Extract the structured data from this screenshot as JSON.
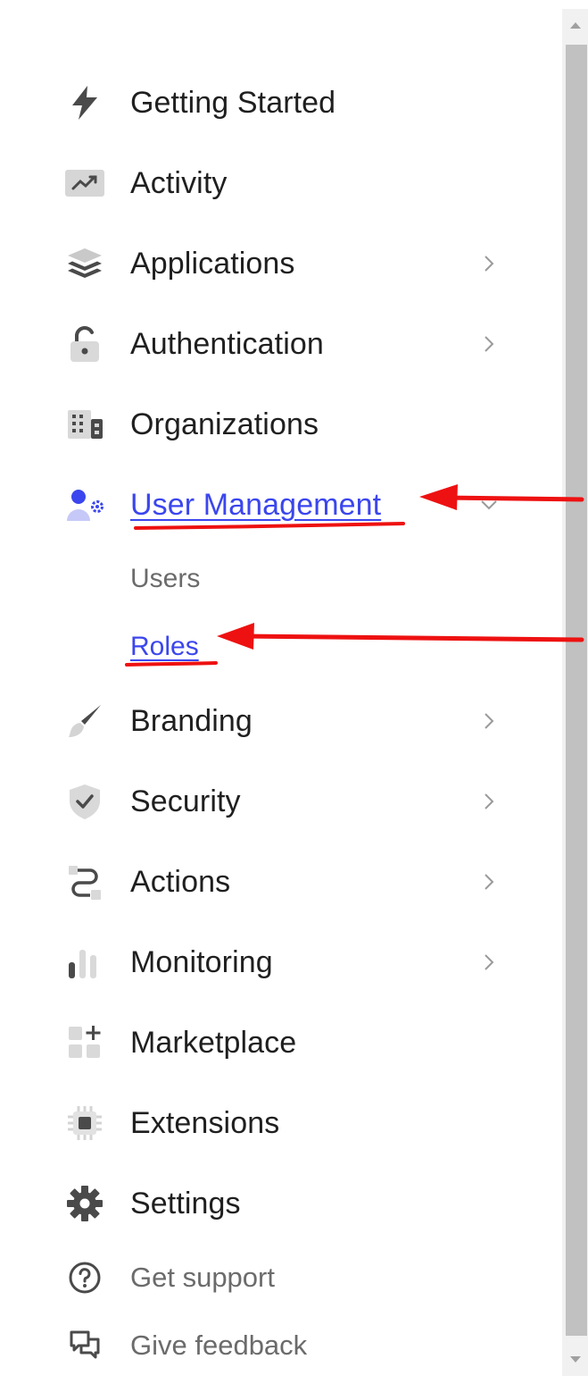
{
  "nav": {
    "items": [
      {
        "label": "Getting Started",
        "icon": "lightning-icon"
      },
      {
        "label": "Activity",
        "icon": "activity-chart-icon"
      },
      {
        "label": "Applications",
        "icon": "layers-icon",
        "expandable": true
      },
      {
        "label": "Authentication",
        "icon": "lock-icon",
        "expandable": true
      },
      {
        "label": "Organizations",
        "icon": "building-icon"
      },
      {
        "label": "User Management",
        "icon": "user-gear-icon",
        "expanded": true,
        "active": true
      },
      {
        "label": "Branding",
        "icon": "paintbrush-icon",
        "expandable": true
      },
      {
        "label": "Security",
        "icon": "shield-check-icon",
        "expandable": true
      },
      {
        "label": "Actions",
        "icon": "flow-icon",
        "expandable": true
      },
      {
        "label": "Monitoring",
        "icon": "bar-chart-icon",
        "expandable": true
      },
      {
        "label": "Marketplace",
        "icon": "grid-plus-icon"
      },
      {
        "label": "Extensions",
        "icon": "chip-icon"
      },
      {
        "label": "Settings",
        "icon": "gear-icon"
      }
    ],
    "user_management_children": [
      {
        "label": "Users",
        "active": false
      },
      {
        "label": "Roles",
        "active": true
      }
    ]
  },
  "footer": {
    "support_label": "Get support",
    "feedback_label": "Give feedback"
  },
  "colors": {
    "active": "#3b46ee",
    "text": "#1f1f1f",
    "muted": "#6b6b6b",
    "icon": "#4a4a4a",
    "annotation": "#ee1111"
  }
}
